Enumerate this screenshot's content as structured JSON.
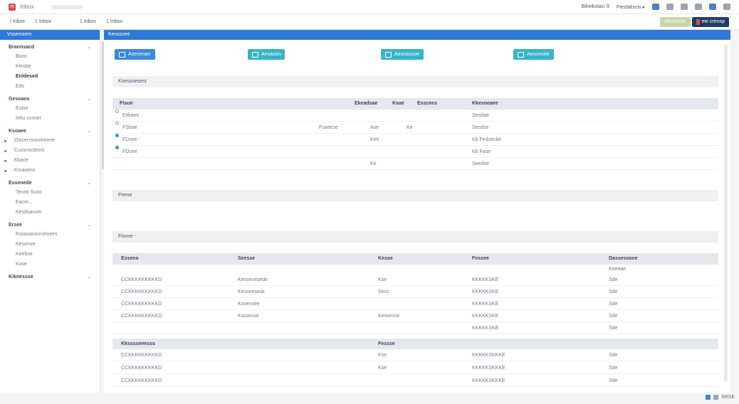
{
  "topbar": {
    "logo_glyph": "m",
    "app_name": "Inbox",
    "links": [
      "Bikeikolaci ß",
      "Piezlatiscis ▸"
    ]
  },
  "subbar": {
    "tabs": [
      "I Inbox",
      "1 Inbox",
      "1 Inbox",
      "1 Inbox"
    ],
    "btn_ghost": "Ieksevoor",
    "btn_dark": "ew crtrosp"
  },
  "sidebar": {
    "active": "Vssensiom",
    "sections": [
      {
        "label": "Brannsacd",
        "items": [
          {
            "t": "Bozo"
          },
          {
            "t": "Kleobe"
          },
          {
            "t": "Enldesed",
            "strong": true,
            "dot": false
          },
          {
            "t": "Eds"
          }
        ]
      },
      {
        "label": "Gesoaos",
        "items": [
          {
            "t": "Eoise"
          },
          {
            "t": "Ieitu cusser"
          }
        ]
      },
      {
        "label": "Ksoaee",
        "items": [
          {
            "t": "Oiscerrsnoshirene",
            "dot": true
          },
          {
            "t": "Cussnscteors",
            "dot": true
          },
          {
            "t": "Kbace",
            "dot": true
          },
          {
            "t": "Krsasens",
            "dot": true
          }
        ]
      },
      {
        "label": "Essenede",
        "items": [
          {
            "t": "Tecoo Suso"
          },
          {
            "t": "Eacer..."
          },
          {
            "t": "Kesdsasser"
          }
        ]
      },
      {
        "label": "Ersee",
        "items": [
          {
            "t": "Kssasaosorshsees"
          },
          {
            "t": "Kesonse"
          },
          {
            "t": "Keebse"
          },
          {
            "t": "Kose"
          }
        ]
      },
      {
        "label": "Kiknessse",
        "items": []
      }
    ]
  },
  "main": {
    "header": "Kessssee",
    "quick_buttons": [
      "Aseoeoan",
      "Aesaosn",
      "Aesoaosoe",
      "Aesoeooe"
    ],
    "panel1_title": "Ksessoesesr",
    "table1": {
      "columns": [
        "Fisun",
        "Ekeadsae",
        "Kaae",
        "Esscees",
        "Kkesneaee"
      ],
      "rows": [
        {
          "status": "green",
          "name": "Etikaee",
          "c2": "",
          "c3": "",
          "c4": "",
          "c5": "Sesdae"
        },
        {
          "status": "green",
          "name": "FSbae",
          "c2": "Fsaeese",
          "c3": "Ase",
          "c4": "Ke",
          "c5": "Sesdse"
        },
        {
          "status": "blue",
          "name": "FDsee -",
          "c2": "",
          "c3": "Kee",
          "c4": "",
          "c5": "Kb Fedsecke"
        },
        {
          "status": "blue",
          "name": "FDsee",
          "c2": "",
          "c3": "",
          "c4": "",
          "c5": "Kb Fase"
        },
        {
          "status": "none",
          "name": "",
          "c2": "",
          "c3": "Ke",
          "c4": "",
          "c5": "Seedse"
        }
      ]
    },
    "panel2_title": "Feese",
    "panel3_title": "Fisose -",
    "table2": {
      "columns": [
        "Esseco",
        "Seesse",
        "Kesse",
        "Fessee",
        "Dassessoee"
      ],
      "subcol": "Keeeae",
      "rows": [
        [
          "CCKKKKKKKKKD",
          "Kessesesede",
          "Kse",
          "KKKKKSKE",
          "Sde"
        ],
        [
          "CCKKKKKKKKKD",
          "Kesseesesk",
          "Sess",
          "KKKKKSKE",
          "Sde"
        ],
        [
          "CCKKKKKKKKKD",
          "Kssensee",
          "",
          "KKKKKSKE",
          "Sde"
        ],
        [
          "CCKKKKKKKKKD",
          "Ksssesse",
          "Kessesse",
          "KKKKKSKE",
          "Sde"
        ],
        [
          "",
          "",
          "",
          "KKKKKSKE",
          "Sde"
        ]
      ],
      "subsection": {
        "label": "Kksssseeesss",
        "label2": "Fessse"
      },
      "rows2": [
        [
          "CCKKKKKKKKKD",
          "",
          "Kse",
          "KKKKKSKKKE",
          "Sde"
        ],
        [
          "CCKKKKKKKKKD",
          "",
          "Kse",
          "KKKKKSKKKE",
          "Sde"
        ],
        [
          "CCKKKKKKKKKD",
          "",
          "",
          "KKKKKSKKKE",
          "Sde"
        ]
      ]
    }
  },
  "tray": {
    "text": "SRSE"
  }
}
